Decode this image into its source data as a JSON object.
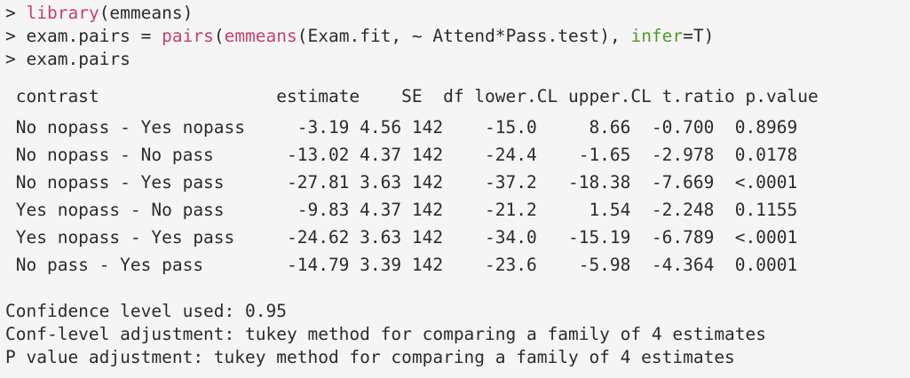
{
  "console": {
    "prompt": ">",
    "commands": [
      {
        "fn": "library",
        "arg_text": "(emmeans)"
      },
      {
        "lhs": "exam.pairs = ",
        "fn1": "pairs",
        "p1": "(",
        "fn2": "emmeans",
        "rest": "(Exam.fit, ~ Attend*Pass.test), ",
        "named_arg": "infer",
        "named_val": "=T)"
      },
      {
        "text": "exam.pairs"
      }
    ],
    "output": {
      "header": " contrast                 estimate    SE  df lower.CL upper.CL t.ratio p.value",
      "rows": [
        " No nopass - Yes nopass     -3.19 4.56 142    -15.0     8.66  -0.700  0.8969",
        " No nopass - No pass       -13.02 4.37 142    -24.4    -1.65  -2.978  0.0178",
        " No nopass - Yes pass      -27.81 3.63 142    -37.2   -18.38  -7.669  <.0001",
        " Yes nopass - No pass       -9.83 4.37 142    -21.2     1.54  -2.248  0.1155",
        " Yes nopass - Yes pass     -24.62 3.63 142    -34.0   -15.19  -6.789  <.0001",
        " No pass - Yes pass        -14.79 3.39 142    -23.6    -5.98  -4.364  0.0001"
      ],
      "notes": [
        "Confidence level used: 0.95",
        "Conf-level adjustment: tukey method for comparing a family of 4 estimates",
        "P value adjustment: tukey method for comparing a family of 4 estimates"
      ]
    },
    "colors": {
      "background": "#f5f5f5",
      "text": "#2b2b2b",
      "function": "#c4416e",
      "named_argument": "#4f9a2a"
    }
  }
}
